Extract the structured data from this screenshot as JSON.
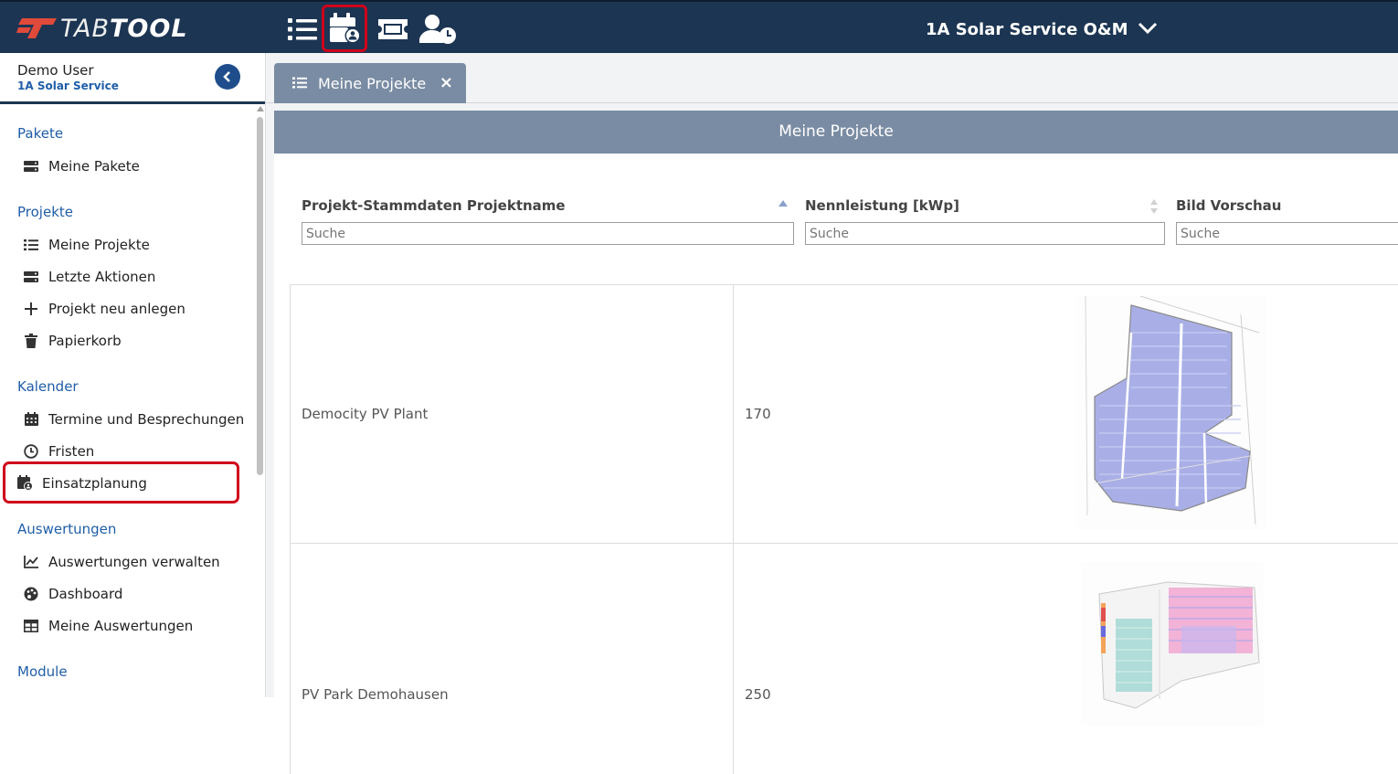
{
  "topbar": {
    "logo_bold_prefix": "T",
    "logo_thin": "TAB",
    "logo_bold": "TOOL",
    "company": "1A Solar Service O&M",
    "icons": [
      "list-icon",
      "calendar-user-icon",
      "ticket-icon",
      "user-clock-icon"
    ]
  },
  "user": {
    "name": "Demo User",
    "org": "1A Solar Service"
  },
  "nav": {
    "pakete": {
      "title": "Pakete",
      "items": [
        {
          "label": "Meine Pakete",
          "icon": "server-icon"
        }
      ]
    },
    "projekte": {
      "title": "Projekte",
      "items": [
        {
          "label": "Meine Projekte",
          "icon": "list-icon"
        },
        {
          "label": "Letzte Aktionen",
          "icon": "server-icon"
        },
        {
          "label": "Projekt neu anlegen",
          "icon": "plus-icon"
        },
        {
          "label": "Papierkorb",
          "icon": "trash-icon"
        }
      ]
    },
    "kalender": {
      "title": "Kalender",
      "items": [
        {
          "label": "Termine und Besprechungen",
          "icon": "calendar-icon"
        },
        {
          "label": "Fristen",
          "icon": "clock-icon"
        },
        {
          "label": "Einsatzplanung",
          "icon": "calendar-user-icon"
        }
      ]
    },
    "auswertungen": {
      "title": "Auswertungen",
      "items": [
        {
          "label": "Auswertungen verwalten",
          "icon": "line-chart-icon"
        },
        {
          "label": "Dashboard",
          "icon": "palette-icon"
        },
        {
          "label": "Meine Auswertungen",
          "icon": "table-icon"
        }
      ]
    },
    "module": {
      "title": "Module"
    }
  },
  "tab": {
    "label": "Meine Projekte",
    "close": "×"
  },
  "panel": {
    "title": "Meine Projekte"
  },
  "table": {
    "headers": [
      "Projekt-Stammdaten Projektname",
      "Nennleistung [kWp]",
      "Bild Vorschau"
    ],
    "search_placeholder": "Suche",
    "rows": [
      {
        "name": "Democity PV Plant",
        "power": "170",
        "image": "site-plan-thumbnail"
      },
      {
        "name": "PV Park Demohausen",
        "power": "250",
        "image": "site-plan-thumbnail"
      }
    ]
  }
}
